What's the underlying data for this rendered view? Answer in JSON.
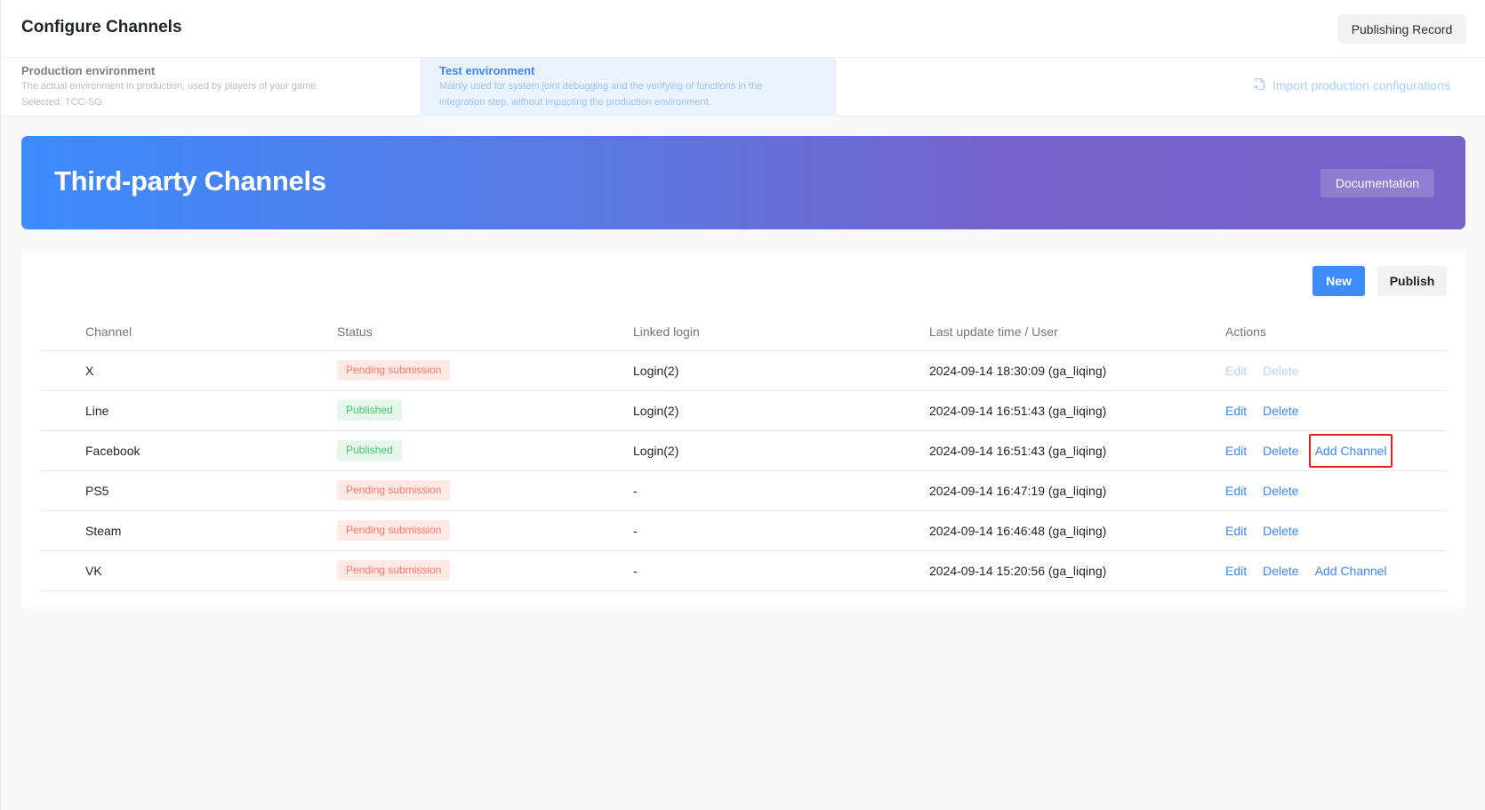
{
  "header": {
    "title": "Configure Channels",
    "publishing_record_label": "Publishing Record"
  },
  "environments": {
    "production": {
      "title": "Production environment",
      "description": "The actual environment in production, used by players of your game.",
      "selected": "Selected: TCC-SG"
    },
    "test": {
      "title": "Test environment",
      "description_line1": "Mainly used for system joint debugging and the verifying of functions in the",
      "description_line2": "integration step, without impacting the production environment.",
      "active": true
    },
    "import_label": "Import production configurations",
    "import_icon": "file-import-icon"
  },
  "banner": {
    "title": "Third-party Channels",
    "documentation_label": "Documentation",
    "gradient_start": "#3d8bfd",
    "gradient_end": "#7762c8"
  },
  "toolbar": {
    "new_label": "New",
    "publish_label": "Publish"
  },
  "table": {
    "columns": [
      "Channel",
      "Status",
      "Linked login",
      "Last update time / User",
      "Actions"
    ],
    "rows": [
      {
        "channel": "X",
        "status": "Pending submission",
        "status_type": "pending",
        "linked_login": "Login(2)",
        "updated": "2024-09-14 18:30:09 (ga_liqing)",
        "edit": "Edit",
        "delete": "Delete",
        "actions_disabled": true,
        "add_channel": null
      },
      {
        "channel": "Line",
        "status": "Published",
        "status_type": "published",
        "linked_login": "Login(2)",
        "updated": "2024-09-14 16:51:43 (ga_liqing)",
        "edit": "Edit",
        "delete": "Delete",
        "actions_disabled": false,
        "add_channel": null
      },
      {
        "channel": "Facebook",
        "status": "Published",
        "status_type": "published",
        "linked_login": "Login(2)",
        "updated": "2024-09-14 16:51:43 (ga_liqing)",
        "edit": "Edit",
        "delete": "Delete",
        "actions_disabled": false,
        "add_channel": "Add Channel",
        "highlighted": true
      },
      {
        "channel": "PS5",
        "status": "Pending submission",
        "status_type": "pending",
        "linked_login": "-",
        "updated": "2024-09-14 16:47:19 (ga_liqing)",
        "edit": "Edit",
        "delete": "Delete",
        "actions_disabled": false,
        "add_channel": null
      },
      {
        "channel": "Steam",
        "status": "Pending submission",
        "status_type": "pending",
        "linked_login": "-",
        "updated": "2024-09-14 16:46:48 (ga_liqing)",
        "edit": "Edit",
        "delete": "Delete",
        "actions_disabled": false,
        "add_channel": null
      },
      {
        "channel": "VK",
        "status": "Pending submission",
        "status_type": "pending",
        "linked_login": "-",
        "updated": "2024-09-14 15:20:56 (ga_liqing)",
        "edit": "Edit",
        "delete": "Delete",
        "actions_disabled": false,
        "add_channel": "Add Channel"
      }
    ]
  },
  "colors": {
    "primary": "#3e8bfd",
    "link": "#3e86f4",
    "pending_text": "#f4786a",
    "pending_bg": "#fde9e6",
    "published_text": "#4cbf6d",
    "published_bg": "#e4f7ea",
    "highlight_border": "#ee1c1c"
  }
}
